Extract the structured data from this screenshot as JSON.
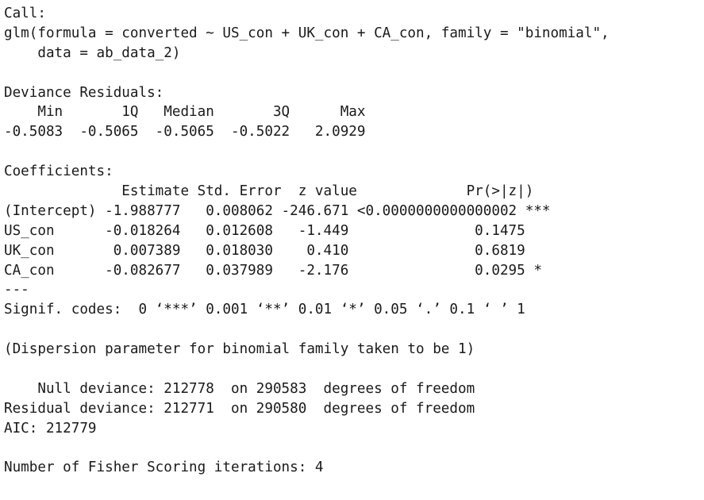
{
  "call": {
    "heading": "Call:",
    "line1": "glm(formula = converted ~ US_con + UK_con + CA_con, family = \"binomial\",",
    "line2": "    data = ab_data_2)"
  },
  "deviance_residuals": {
    "heading": "Deviance Residuals:",
    "header_row": "    Min       1Q   Median       3Q      Max  ",
    "values_row": "-0.5083  -0.5065  -0.5065  -0.5022   2.0929  "
  },
  "coefficients": {
    "heading": "Coefficients:",
    "header_row": "              Estimate Std. Error  z value             Pr(>|z|)    ",
    "rows": [
      "(Intercept) -1.988777   0.008062 -246.671 <0.0000000000000002 ***",
      "US_con      -0.018264   0.012608   -1.449               0.1475    ",
      "UK_con       0.007389   0.018030    0.410               0.6819    ",
      "CA_con      -0.082677   0.037989   -2.176               0.0295 *  "
    ],
    "separator": "---",
    "signif_codes": "Signif. codes:  0 ‘***’ 0.001 ‘**’ 0.01 ‘*’ 0.05 ‘.’ 0.1 ‘ ’ 1"
  },
  "dispersion": "(Dispersion parameter for binomial family taken to be 1)",
  "deviance": {
    "null": "    Null deviance: 212778  on 290583  degrees of freedom",
    "residual": "Residual deviance: 212771  on 290580  degrees of freedom"
  },
  "aic": "AIC: 212779",
  "fisher_iterations": "Number of Fisher Scoring iterations: 4"
}
